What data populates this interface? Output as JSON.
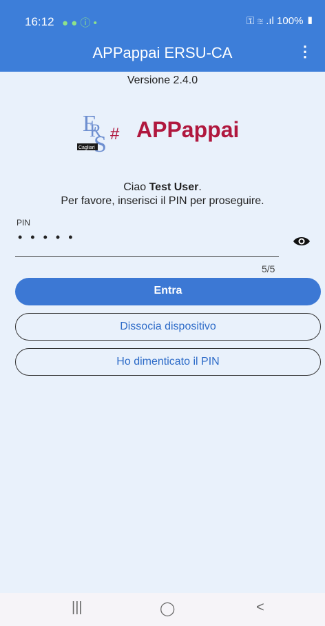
{
  "status": {
    "time": "16:12",
    "icons": "● ● ⓘ •",
    "right": "⚿ ≋ .ıl 100% ▮"
  },
  "appbar": {
    "title": "APPappai ERSU-CA",
    "menu": "⋮"
  },
  "version": "Versione 2.4.0",
  "logo": {
    "brand": "APPappai",
    "sub": "Cagliari"
  },
  "greeting": {
    "hello": "Ciao",
    "user": "Test User",
    "instruction": "Per favore, inserisci il PIN per proseguire."
  },
  "pin": {
    "label": "PIN",
    "masked": "•••••",
    "counter": "5/5"
  },
  "buttons": {
    "enter": "Entra",
    "dissocia": "Dissocia dispositivo",
    "forgot": "Ho dimenticato il PIN"
  },
  "nav": {
    "recents": "|||",
    "home": "◯",
    "back": "<"
  }
}
